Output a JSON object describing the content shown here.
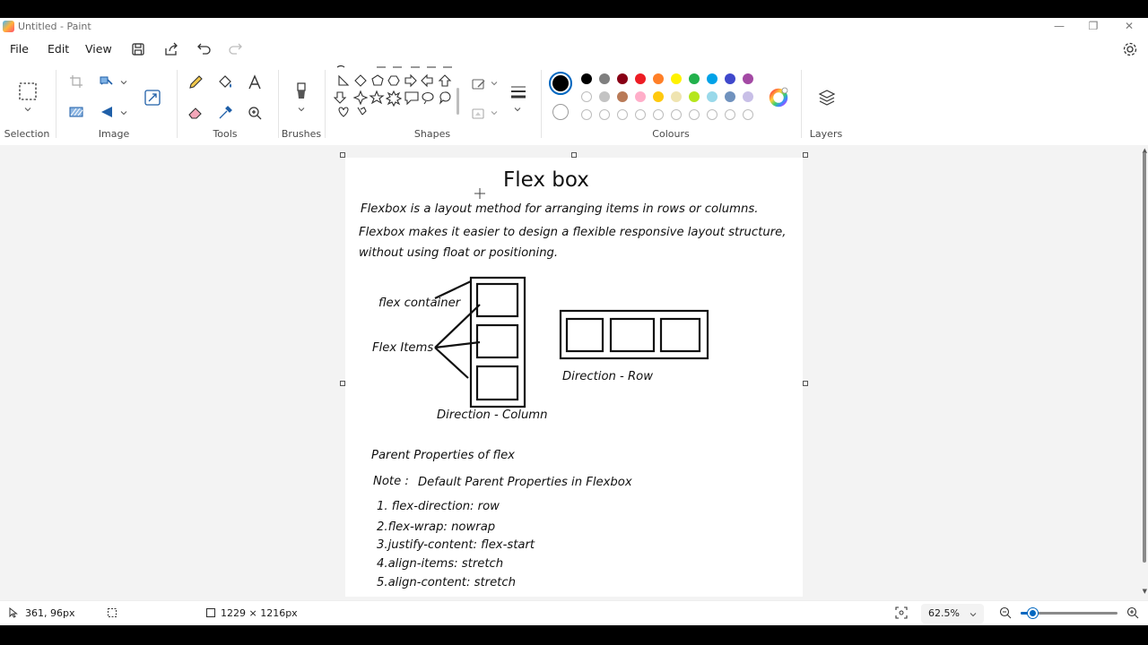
{
  "window": {
    "title": "Untitled - Paint"
  },
  "menu": {
    "file": "File",
    "edit": "Edit",
    "view": "View"
  },
  "ribbon": {
    "groups": {
      "selection": "Selection",
      "image": "Image",
      "tools": "Tools",
      "brushes": "Brushes",
      "shapes": "Shapes",
      "colours": "Colours",
      "layers": "Layers"
    },
    "colours": {
      "current_primary": "#000000",
      "current_secondary": "#ffffff",
      "palette_row1": [
        "#000000",
        "#7f7f7f",
        "#880015",
        "#ed1c24",
        "#ff7f27",
        "#fff200",
        "#22b14c",
        "#00a2e8",
        "#3f48cc",
        "#a349a4"
      ],
      "palette_row2": [
        "#ffffff",
        "#c3c3c3",
        "#b97a57",
        "#ffaec9",
        "#ffc90e",
        "#efe4b0",
        "#b5e61d",
        "#99d9ea",
        "#7092be",
        "#c8bfe7"
      ],
      "custom_slots": 10
    }
  },
  "canvas_content": {
    "title": "Flex box",
    "line1": "Flexbox is a layout method for arranging items in rows or columns.",
    "line2": "Flexbox makes it easier to design a flexible responsive layout structure,",
    "line3": "without using float or positioning.",
    "label_container": "flex container",
    "label_items": "Flex Items",
    "label_column": "Direction - Column",
    "label_row": "Direction - Row",
    "parent_heading": "Parent Properties of flex",
    "note_label": "Note :",
    "note_text": "Default Parent Properties in Flexbox",
    "props": [
      "1. flex-direction: row",
      "2.flex-wrap: nowrap",
      "3.justify-content: flex-start",
      "4.align-items: stretch",
      "5.align-content: stretch"
    ]
  },
  "status": {
    "cursor_pos": "361, 96px",
    "canvas_size": "1229 × 1216px",
    "zoom": "62.5%",
    "zoom_fraction": 0.12
  }
}
